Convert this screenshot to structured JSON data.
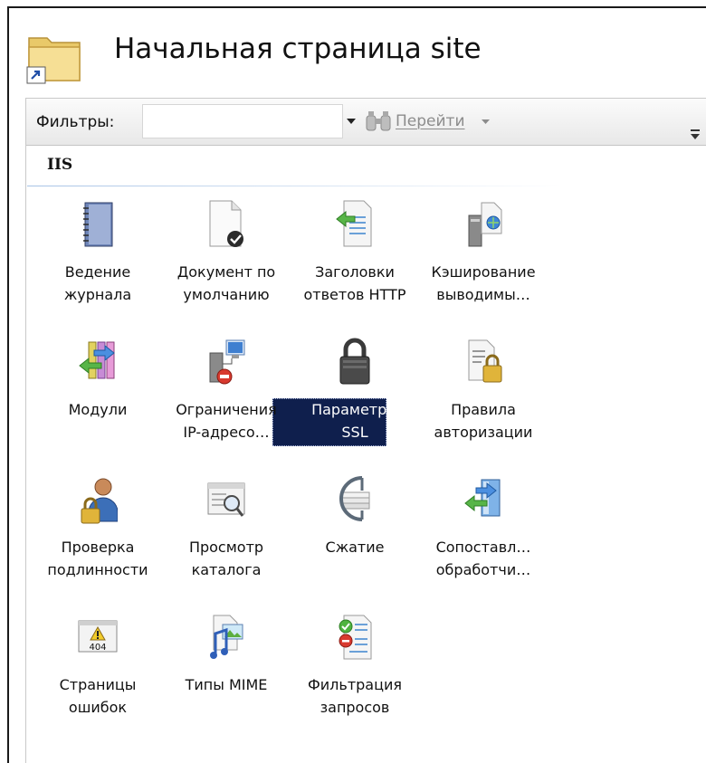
{
  "page": {
    "title": "Начальная страница site"
  },
  "toolbar": {
    "filters_label": "Фильтры:",
    "filter_value": "",
    "go_label": "Перейти"
  },
  "group": {
    "title": "IIS"
  },
  "features": [
    {
      "label": "Ведение\nжурнала",
      "icon": "logging-notebook-icon"
    },
    {
      "label": "Документ по\nумолчанию",
      "icon": "default-document-icon"
    },
    {
      "label": "Заголовки\nответов HTTP",
      "icon": "http-response-headers-icon"
    },
    {
      "label": "Кэширование\nвыводимы…",
      "icon": "output-caching-icon"
    },
    {
      "label": "Модули",
      "icon": "modules-icon"
    },
    {
      "label": "Ограничения\nIP-адресо…",
      "icon": "ip-restrictions-icon"
    },
    {
      "label": "Параметры\nSSL",
      "icon": "ssl-lock-icon",
      "selected": true
    },
    {
      "label": "Правила\nавторизации",
      "icon": "authorization-rules-icon"
    },
    {
      "label": "Проверка\nподлинности",
      "icon": "authentication-icon"
    },
    {
      "label": "Просмотр\nкаталога",
      "icon": "directory-browsing-icon"
    },
    {
      "label": "Сжатие",
      "icon": "compression-icon"
    },
    {
      "label": "Сопоставл…\nобработчи…",
      "icon": "handler-mappings-icon"
    },
    {
      "label": "Страницы\nошибок",
      "icon": "error-pages-icon",
      "icon_text": "404"
    },
    {
      "label": "Типы MIME",
      "icon": "mime-types-icon"
    },
    {
      "label": "Фильтрация\nзапросов",
      "icon": "request-filtering-icon"
    }
  ]
}
